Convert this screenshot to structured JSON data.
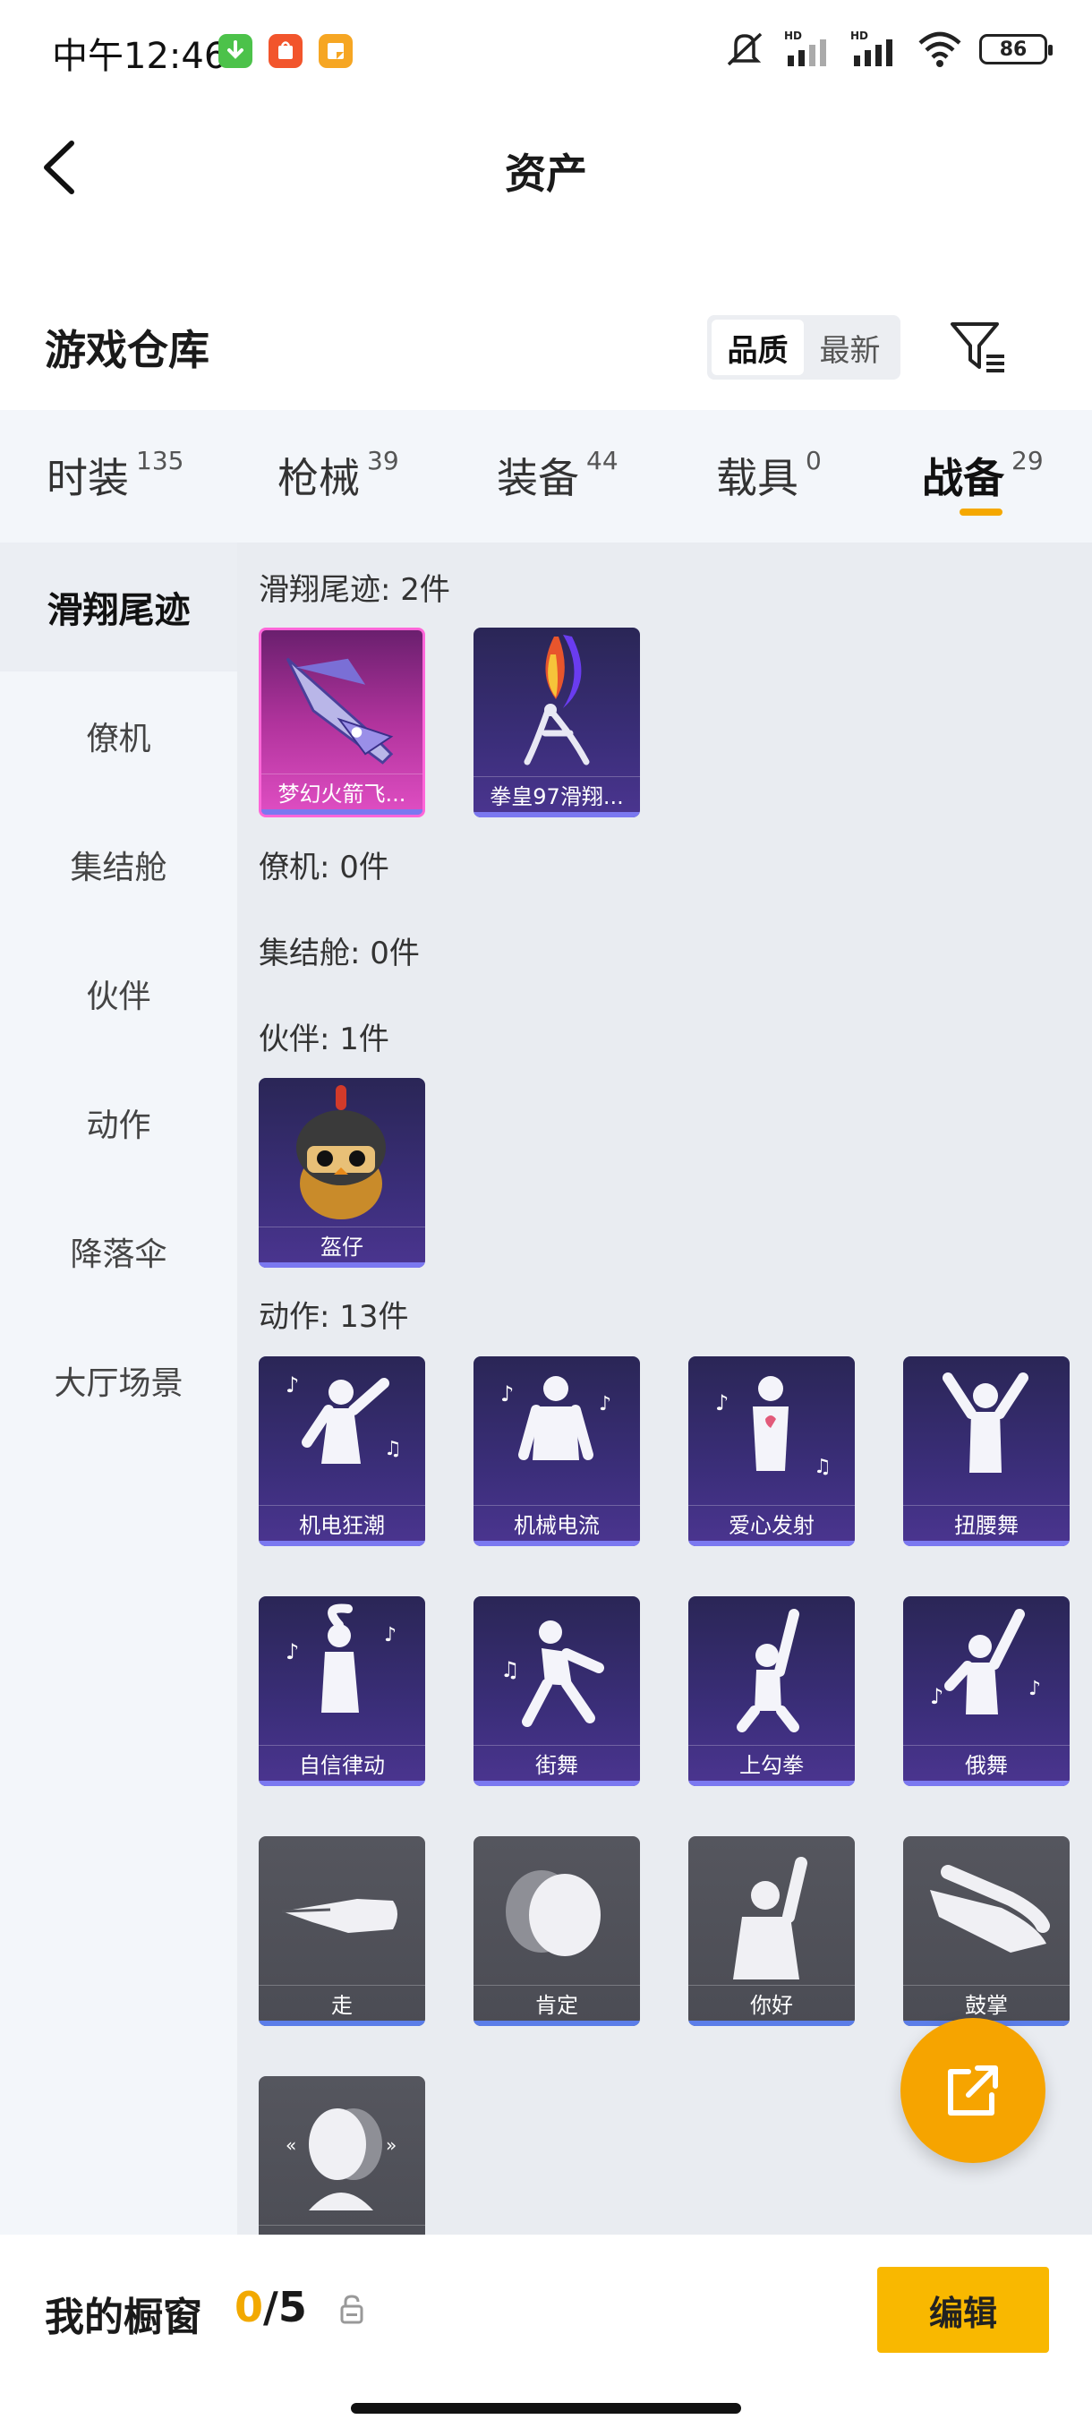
{
  "status_bar": {
    "time": "中午12:46",
    "battery": "86",
    "app_icons": [
      {
        "name": "download-app-icon",
        "color": "#4cc24a"
      },
      {
        "name": "shop-app-icon",
        "color": "#f2552c"
      },
      {
        "name": "notes-app-icon",
        "color": "#f6a623"
      }
    ]
  },
  "header": {
    "title": "资产",
    "back_icon": "back-arrow-icon"
  },
  "warehouse": {
    "title": "游戏仓库",
    "sort_options": [
      "品质",
      "最新"
    ],
    "sort_selected": "品质",
    "filter_icon": "filter-icon"
  },
  "categories": [
    {
      "label": "时装",
      "count": "135"
    },
    {
      "label": "枪械",
      "count": "39"
    },
    {
      "label": "装备",
      "count": "44"
    },
    {
      "label": "载具",
      "count": "0"
    },
    {
      "label": "战备",
      "count": "29",
      "active": true
    }
  ],
  "sidebar": [
    {
      "label": "滑翔尾迹",
      "active": true
    },
    {
      "label": "僚机"
    },
    {
      "label": "集结舱"
    },
    {
      "label": "伙伴"
    },
    {
      "label": "动作"
    },
    {
      "label": "降落伞"
    },
    {
      "label": "大厅场景"
    }
  ],
  "groups": {
    "glide_trail": {
      "label": "滑翔尾迹: 2件",
      "items": [
        "梦幻火箭飞...",
        "拳皇97滑翔..."
      ]
    },
    "wingman": {
      "label": "僚机: 0件"
    },
    "rally_pod": {
      "label": "集结舱: 0件"
    },
    "companion": {
      "label": "伙伴: 1件",
      "items": [
        "盔仔"
      ]
    },
    "emote": {
      "label": "动作: 13件",
      "items": [
        "机电狂潮",
        "机械电流",
        "爱心发射",
        "扭腰舞",
        "自信律动",
        "街舞",
        "上勾拳",
        "俄舞",
        "走",
        "肯定",
        "你好",
        "鼓掌",
        ""
      ]
    }
  },
  "fab": {
    "icon": "share-icon"
  },
  "showcase": {
    "title": "我的橱窗",
    "current": "0",
    "total": "/5",
    "edit_label": "编辑",
    "lock_icon": "lock-icon"
  },
  "colors": {
    "accent": "#f6a400",
    "edit_button": "#f9b800",
    "card_purple": "#3b2e7a",
    "card_pink": "#e04ec3",
    "card_gray": "#4f5058"
  }
}
